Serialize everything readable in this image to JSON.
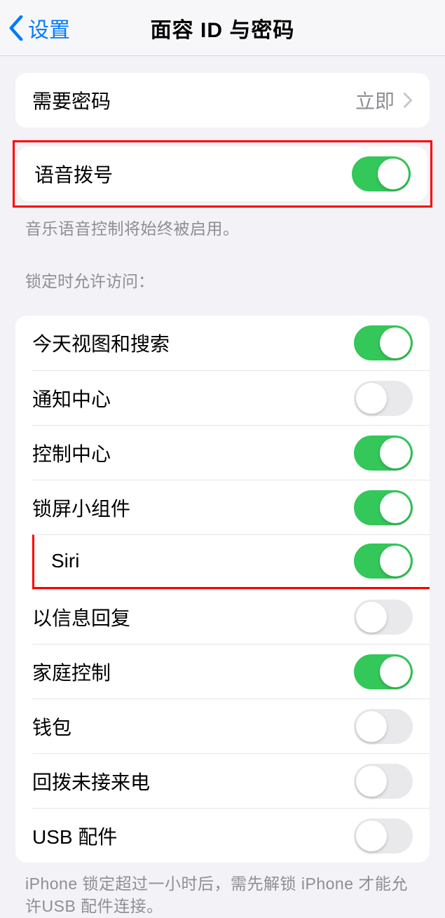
{
  "nav": {
    "back_label": "设置",
    "title": "面容 ID 与密码"
  },
  "require_passcode": {
    "label": "需要密码",
    "value": "立即"
  },
  "voice_dial": {
    "label": "语音拨号",
    "on": true,
    "footer": "音乐语音控制将始终被启用。"
  },
  "lock_section": {
    "header": "锁定时允许访问：",
    "items": [
      {
        "label": "今天视图和搜索",
        "on": true
      },
      {
        "label": "通知中心",
        "on": false
      },
      {
        "label": "控制中心",
        "on": true
      },
      {
        "label": "锁屏小组件",
        "on": true
      },
      {
        "label": "Siri",
        "on": true,
        "highlight": true
      },
      {
        "label": "以信息回复",
        "on": false
      },
      {
        "label": "家庭控制",
        "on": true
      },
      {
        "label": "钱包",
        "on": false
      },
      {
        "label": "回拨未接来电",
        "on": false
      },
      {
        "label": "USB 配件",
        "on": false
      }
    ],
    "footer": "iPhone 锁定超过一小时后，需先解锁 iPhone 才能允许USB 配件连接。"
  }
}
